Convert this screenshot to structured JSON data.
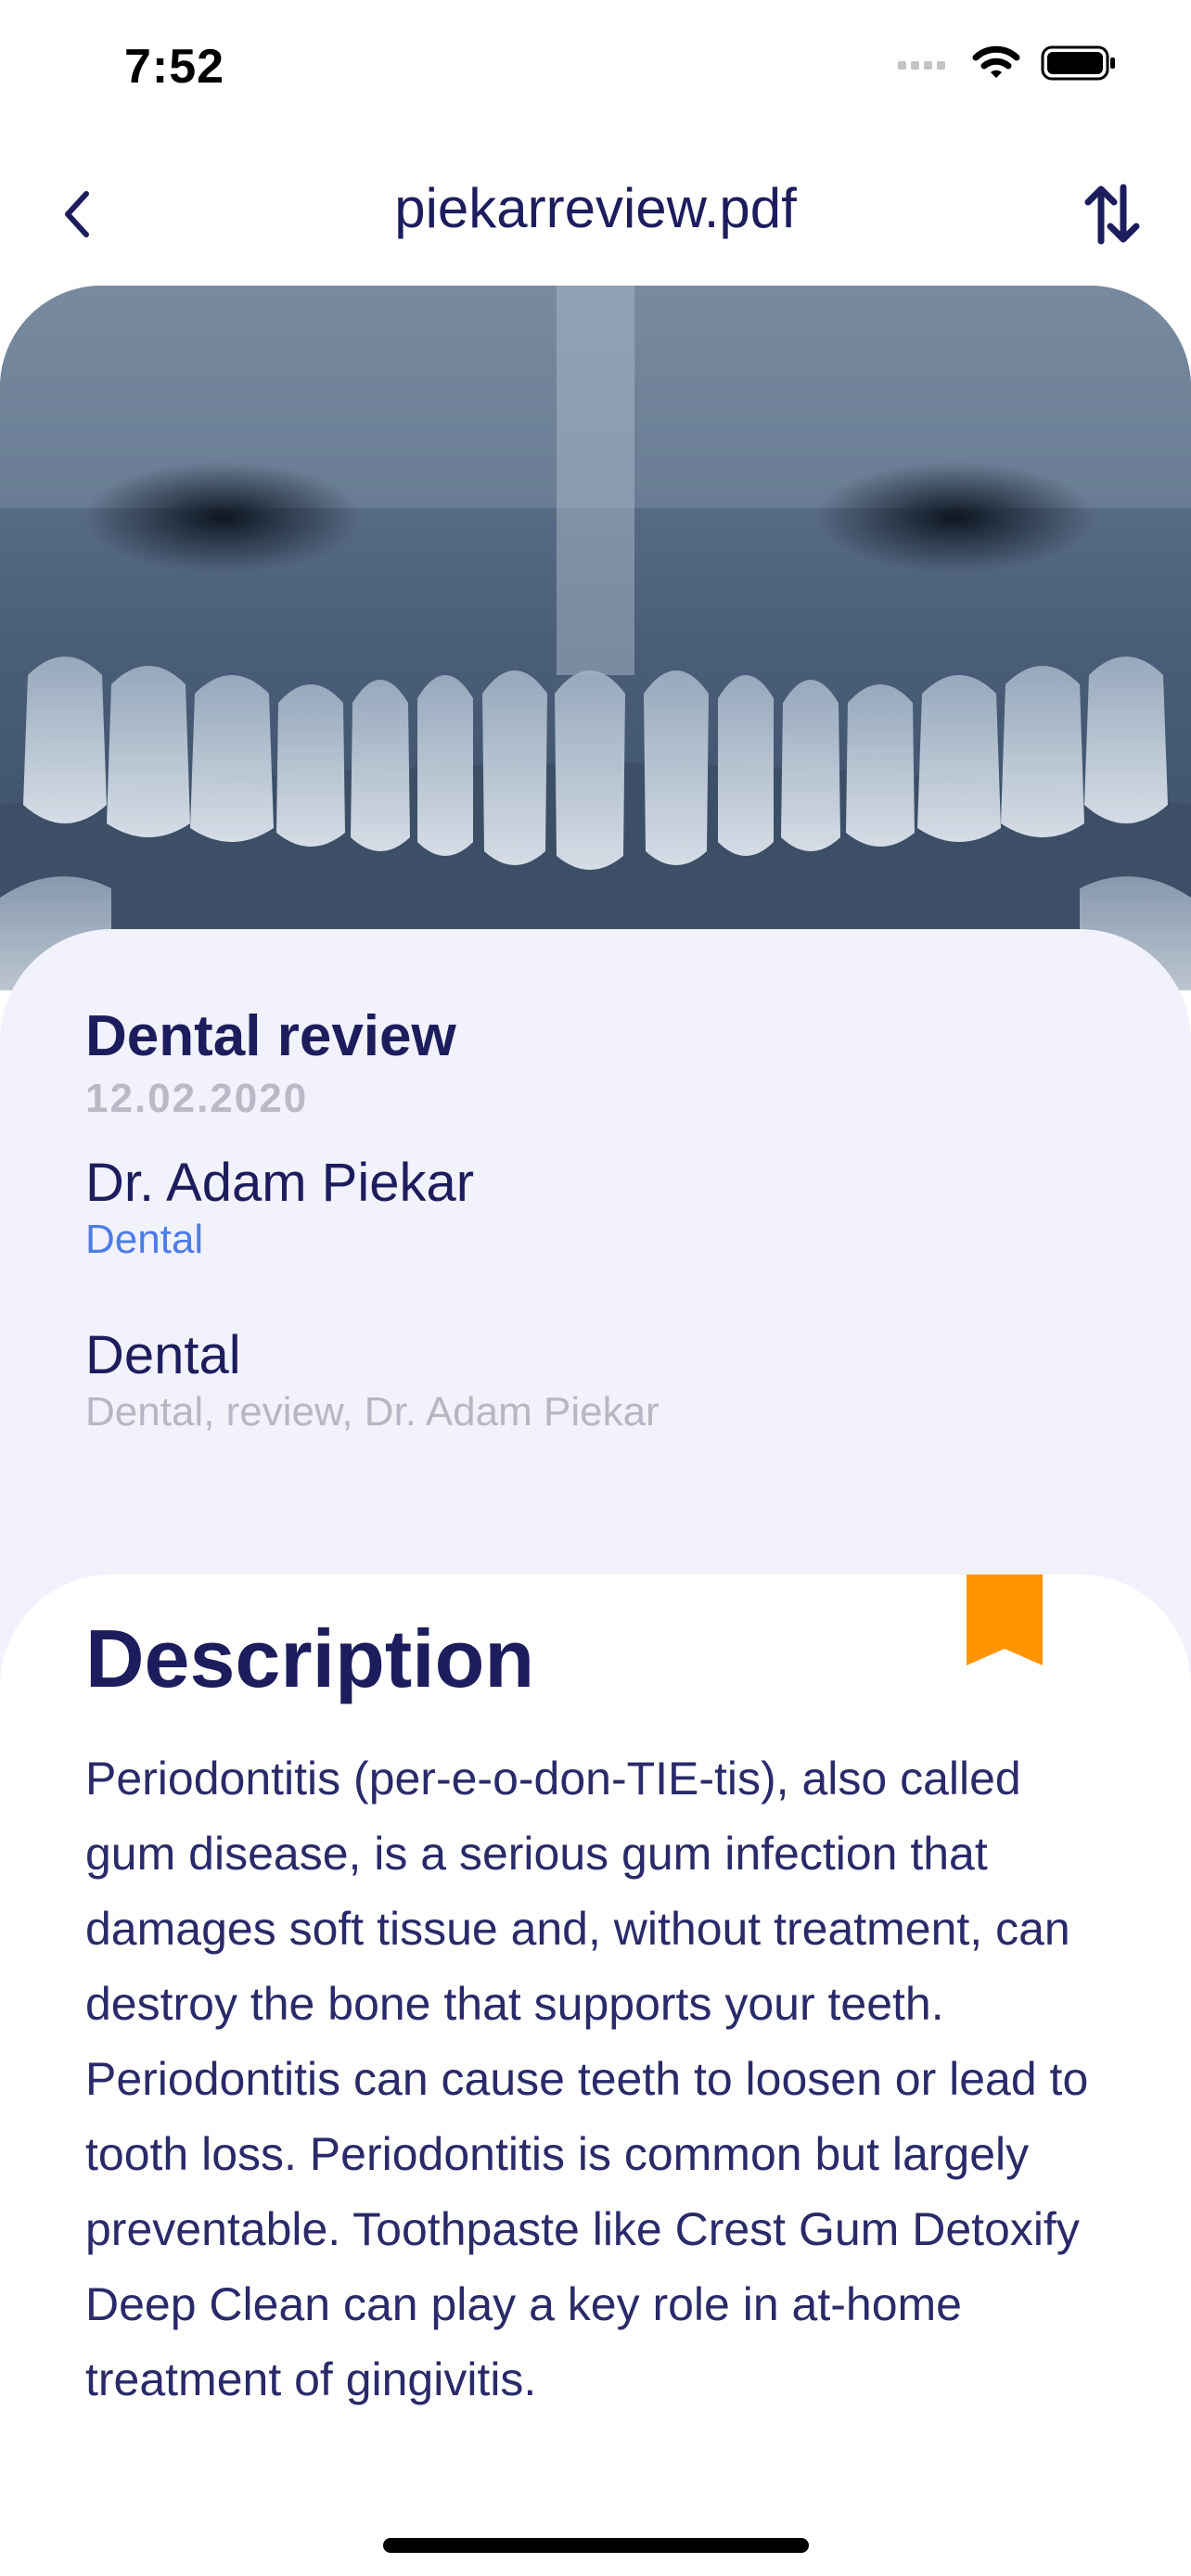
{
  "status_bar": {
    "time": "7:52"
  },
  "nav": {
    "title": "piekarreview.pdf",
    "back_icon": "chevron-left-icon",
    "sort_icon": "sort-arrows-icon"
  },
  "media": {
    "image": "dental-xray-image"
  },
  "document": {
    "title": "Dental review",
    "date": "12.02.2020",
    "doctor_name": "Dr. Adam Piekar",
    "doctor_specialty": "Dental",
    "category": "Dental",
    "tags": "Dental, review, Dr. Adam Piekar"
  },
  "description": {
    "heading": "Description",
    "bookmark_icon": "bookmark-icon",
    "bookmark_color": "#FF9500",
    "text": "Periodontitis (per-e-o-don-TIE-tis), also called gum disease, is a serious gum infection that damages soft tissue and, without treatment, can destroy the bone that supports your teeth. Periodontitis can cause teeth to loosen or lead to tooth loss. Periodontitis is common but largely preventable. Toothpaste like Crest Gum Detoxify Deep Clean can play a key role in at-home treatment of gingivitis."
  },
  "colors": {
    "primary_text": "#1D1D5E",
    "accent_blue": "#4D7CE8",
    "card_background": "#F2F2FC"
  }
}
